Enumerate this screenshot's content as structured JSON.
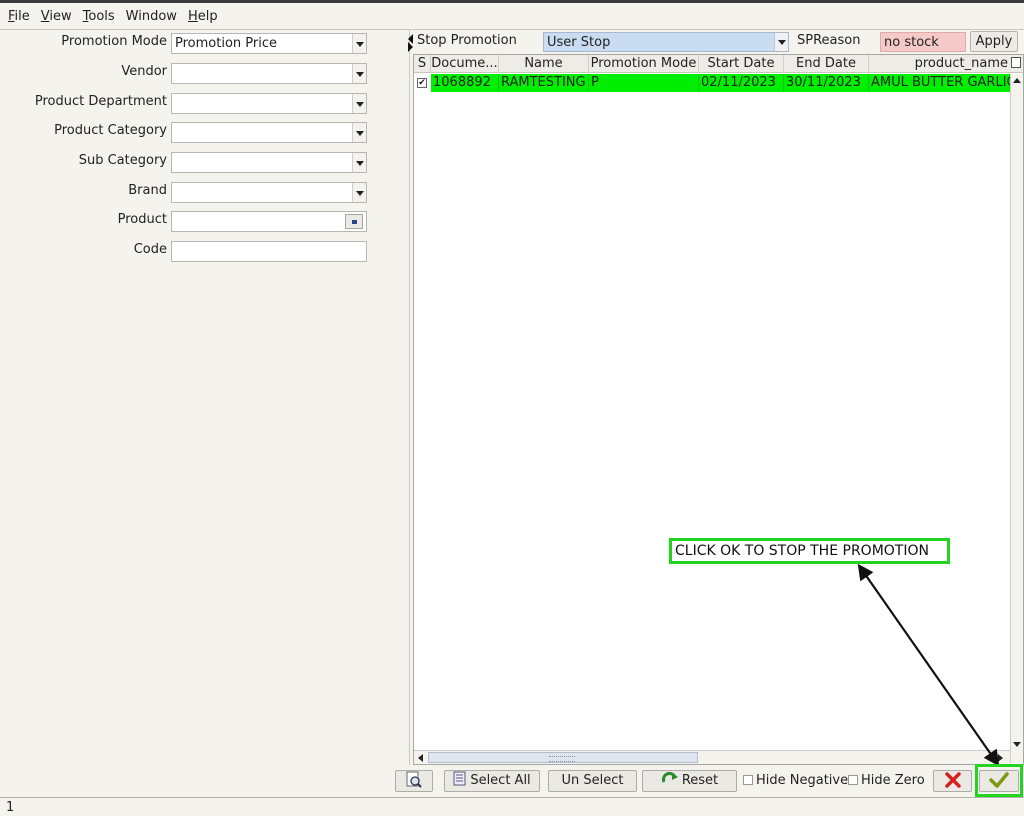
{
  "menu": [
    {
      "label": "File"
    },
    {
      "label": "View"
    },
    {
      "label": "Tools"
    },
    {
      "label": "Window"
    },
    {
      "label": "Help"
    }
  ],
  "filters": {
    "promotion_mode": {
      "label": "Promotion Mode",
      "value": "Promotion Price"
    },
    "vendor": {
      "label": "Vendor",
      "value": ""
    },
    "product_department": {
      "label": "Product Department",
      "value": ""
    },
    "product_category": {
      "label": "Product Category",
      "value": ""
    },
    "sub_category": {
      "label": "Sub Category",
      "value": ""
    },
    "brand": {
      "label": "Brand",
      "value": ""
    },
    "product": {
      "label": "Product",
      "value": ""
    },
    "code": {
      "label": "Code",
      "value": ""
    }
  },
  "stop_bar": {
    "label": "Stop Promotion",
    "stop_type": "User Stop",
    "reason_label": "SPReason",
    "reason_value": "no stock",
    "apply": "Apply"
  },
  "grid": {
    "columns": [
      "S",
      "Docume...",
      "Name",
      "Promotion Mode",
      "Start Date",
      "End Date",
      "product_name"
    ],
    "rows": [
      {
        "selected": true,
        "document": "1068892",
        "name": "RAMTESTING",
        "mode": "P",
        "start": "02/11/2023",
        "end": "30/11/2023",
        "product": "AMUL BUTTER GARLIC"
      }
    ]
  },
  "annotation": {
    "text": "CLICK OK TO STOP THE PROMOTION",
    "color": "#21d421"
  },
  "toolbar": {
    "select_all": "Select All",
    "unselect": "Un Select",
    "reset": "Reset",
    "hide_negative": "Hide Negative",
    "hide_zero": "Hide Zero"
  },
  "status": {
    "text": "1"
  },
  "colors": {
    "row_highlight": "#00ee00",
    "stop_combo": "#c9dcf2",
    "reason_field": "#f6c9c9"
  }
}
